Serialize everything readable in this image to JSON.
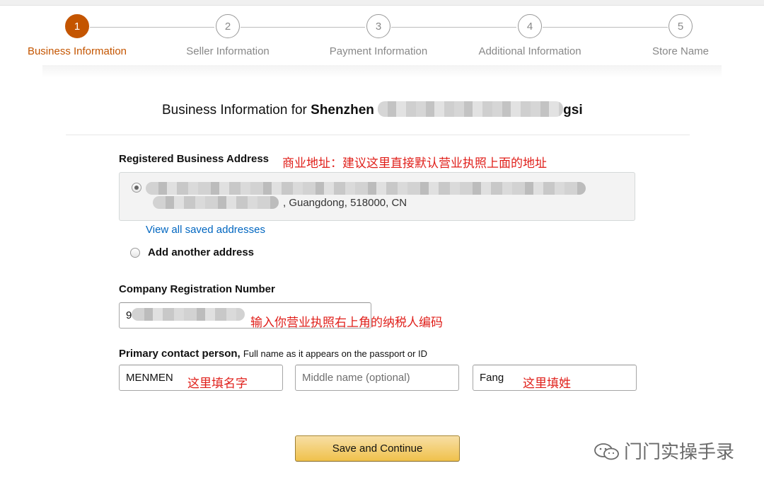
{
  "stepper": {
    "steps": [
      {
        "number": "1",
        "label": "Business Information"
      },
      {
        "number": "2",
        "label": "Seller Information"
      },
      {
        "number": "3",
        "label": "Payment Information"
      },
      {
        "number": "4",
        "label": "Additional Information"
      },
      {
        "number": "5",
        "label": "Store Name"
      }
    ]
  },
  "heading": {
    "prefix": "Business Information for",
    "company_start": "Shenzhen",
    "company_end": "gsi"
  },
  "address": {
    "label": "Registered Business Address",
    "note": "商业地址：建议这里直接默认营业执照上面的地址",
    "visible_text": ", Guangdong, 518000, CN",
    "view_all_link": "View all saved addresses",
    "add_another": "Add another address"
  },
  "registration": {
    "label": "Company Registration Number",
    "value_prefix": "9",
    "note": "输入你营业执照右上角的纳税人编码"
  },
  "contact": {
    "label": "Primary contact person,",
    "sublabel": "Full name as it appears on the passport or ID",
    "first_name": "MENMEN",
    "first_note": "这里填名字",
    "middle_placeholder": "Middle name (optional)",
    "last_name": "Fang",
    "last_note": "这里填姓"
  },
  "actions": {
    "save_continue": "Save and Continue"
  },
  "watermark": {
    "text": "门门实操手录"
  },
  "colors": {
    "active_step": "#c45500",
    "annotation_red": "#e0201b",
    "link_blue": "#0066c0",
    "button_yellow": "#f0c14b"
  }
}
